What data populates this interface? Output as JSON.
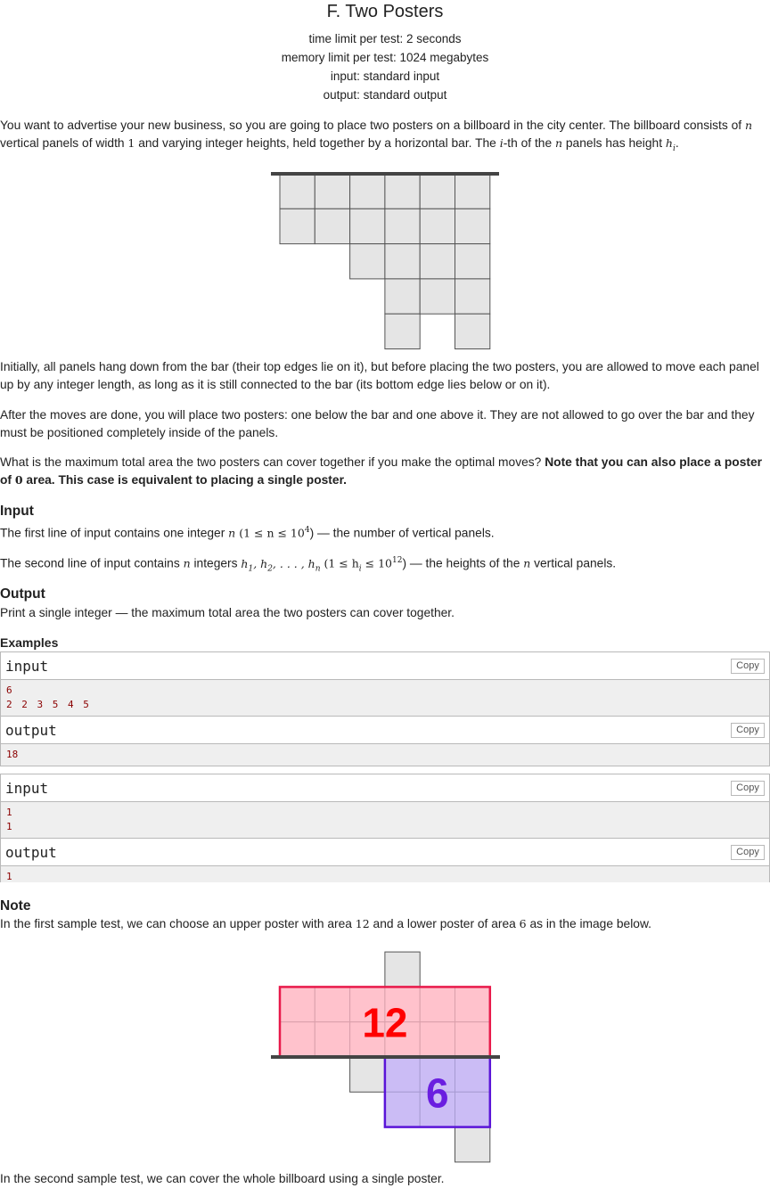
{
  "problem": {
    "title": "F. Two Posters",
    "time_limit": "time limit per test: 2 seconds",
    "memory_limit": "memory limit per test: 1024 megabytes",
    "input_file": "input: standard input",
    "output_file": "output: standard output"
  },
  "statement": {
    "p1_a": "You want to advertise your new business, so you are going to place two posters on a billboard in the city center. The billboard consists of ",
    "p1_n": "n",
    "p1_b": " vertical panels of width ",
    "p1_one": "1",
    "p1_c": " and varying integer heights, held together by a horizontal bar. The ",
    "p1_i": "i",
    "p1_d": "-th of the ",
    "p1_n2": "n",
    "p1_e": " panels has height ",
    "p1_h": "h",
    "p1_hi": "i",
    "p1_f": ".",
    "p2": "Initially, all panels hang down from the bar (their top edges lie on it), but before placing the two posters, you are allowed to move each panel up by any integer length, as long as it is still connected to the bar (its bottom edge lies below or on it).",
    "p3": "After the moves are done, you will place two posters: one below the bar and one above it. They are not allowed to go over the bar and they must be positioned completely inside of the panels.",
    "p4_a": "What is the maximum total area the two posters can cover together if you make the optimal moves? ",
    "p4_b": "Note that you can also place a poster of ",
    "p4_zero": "0",
    "p4_c": " area. This case is equivalent to placing a single poster."
  },
  "figure1_heights": [
    2,
    2,
    3,
    5,
    4,
    5
  ],
  "input_section": {
    "title": "Input",
    "l1_a": "The first line of input contains one integer ",
    "l1_n": "n",
    "l1_constraint": " (1 ≤ n ≤ 10",
    "l1_exp": "4",
    "l1_b": ") — the number of vertical panels.",
    "l2_a": "The second line of input contains ",
    "l2_n": "n",
    "l2_b": " integers ",
    "l2_seq": "h",
    "l2_constraint": " (1 ≤ h",
    "l2_le": " ≤ 10",
    "l2_exp": "12",
    "l2_c": ") — the heights of the ",
    "l2_n2": "n",
    "l2_d": " vertical panels."
  },
  "output_section": {
    "title": "Output",
    "text": "Print a single integer — the maximum total area the two posters can cover together."
  },
  "examples": {
    "title": "Examples",
    "copy_label": "Copy",
    "input_label": "input",
    "output_label": "output",
    "ex1_input": [
      "6",
      "2 2 3 5 4 5"
    ],
    "ex1_output": [
      "18"
    ],
    "ex2_input": [
      "1",
      "1"
    ],
    "ex2_output": [
      "1"
    ]
  },
  "note": {
    "title": "Note",
    "l1_a": "In the first sample test, we can choose an upper poster with area ",
    "l1_12": "12",
    "l1_b": " and a lower poster of area ",
    "l1_6": "6",
    "l1_c": " as in the image below.",
    "upper_area_label": "12",
    "lower_area_label": "6",
    "l2": "In the second sample test, we can cover the whole billboard using a single poster."
  },
  "colors": {
    "upper_poster_fill": "#ffc2cc",
    "upper_poster_stroke": "#e8194a",
    "upper_text": "#ff0000",
    "lower_poster_fill": "#cbbcf5",
    "lower_poster_stroke": "#5a14d8",
    "lower_text": "#6a1ee0",
    "panel_fill": "#e5e5e5",
    "bar": "#444444",
    "sample_bg": "#efefef",
    "sample_text": "#8b0000"
  }
}
